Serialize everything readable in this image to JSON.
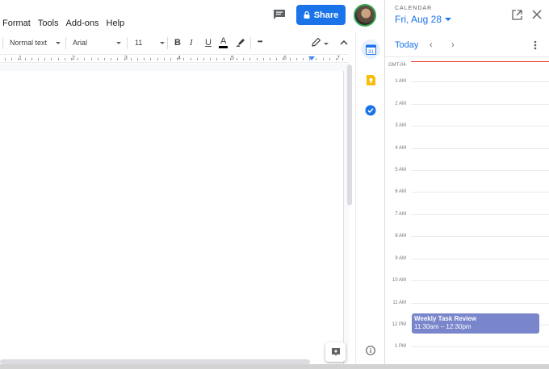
{
  "menu": {
    "items": [
      "Format",
      "Tools",
      "Add-ons",
      "Help"
    ]
  },
  "header": {
    "share_label": "Share"
  },
  "toolbar": {
    "style": "Normal text",
    "font": "Arial",
    "size": "11",
    "bold": "B",
    "italic": "I",
    "underline": "U",
    "text_color": "A",
    "more": "•••"
  },
  "ruler": {
    "numbers": [
      "1",
      "2",
      "3",
      "4",
      "5",
      "6",
      "7"
    ]
  },
  "calendar": {
    "label": "CALENDAR",
    "date": "Fri, Aug 28",
    "today": "Today",
    "prev": "‹",
    "next": "›",
    "timezone": "GMT-04",
    "hours": [
      "1 AM",
      "2 AM",
      "3 AM",
      "4 AM",
      "5 AM",
      "6 AM",
      "7 AM",
      "8 AM",
      "9 AM",
      "10 AM",
      "11 AM",
      "12 PM",
      "1 PM"
    ],
    "event": {
      "title": "Weekly Task Review",
      "time": "11:30am – 12:30pm",
      "color": "#7986cb"
    }
  },
  "colors": {
    "accent": "#1a73e8",
    "now_line": "#ea4335"
  }
}
